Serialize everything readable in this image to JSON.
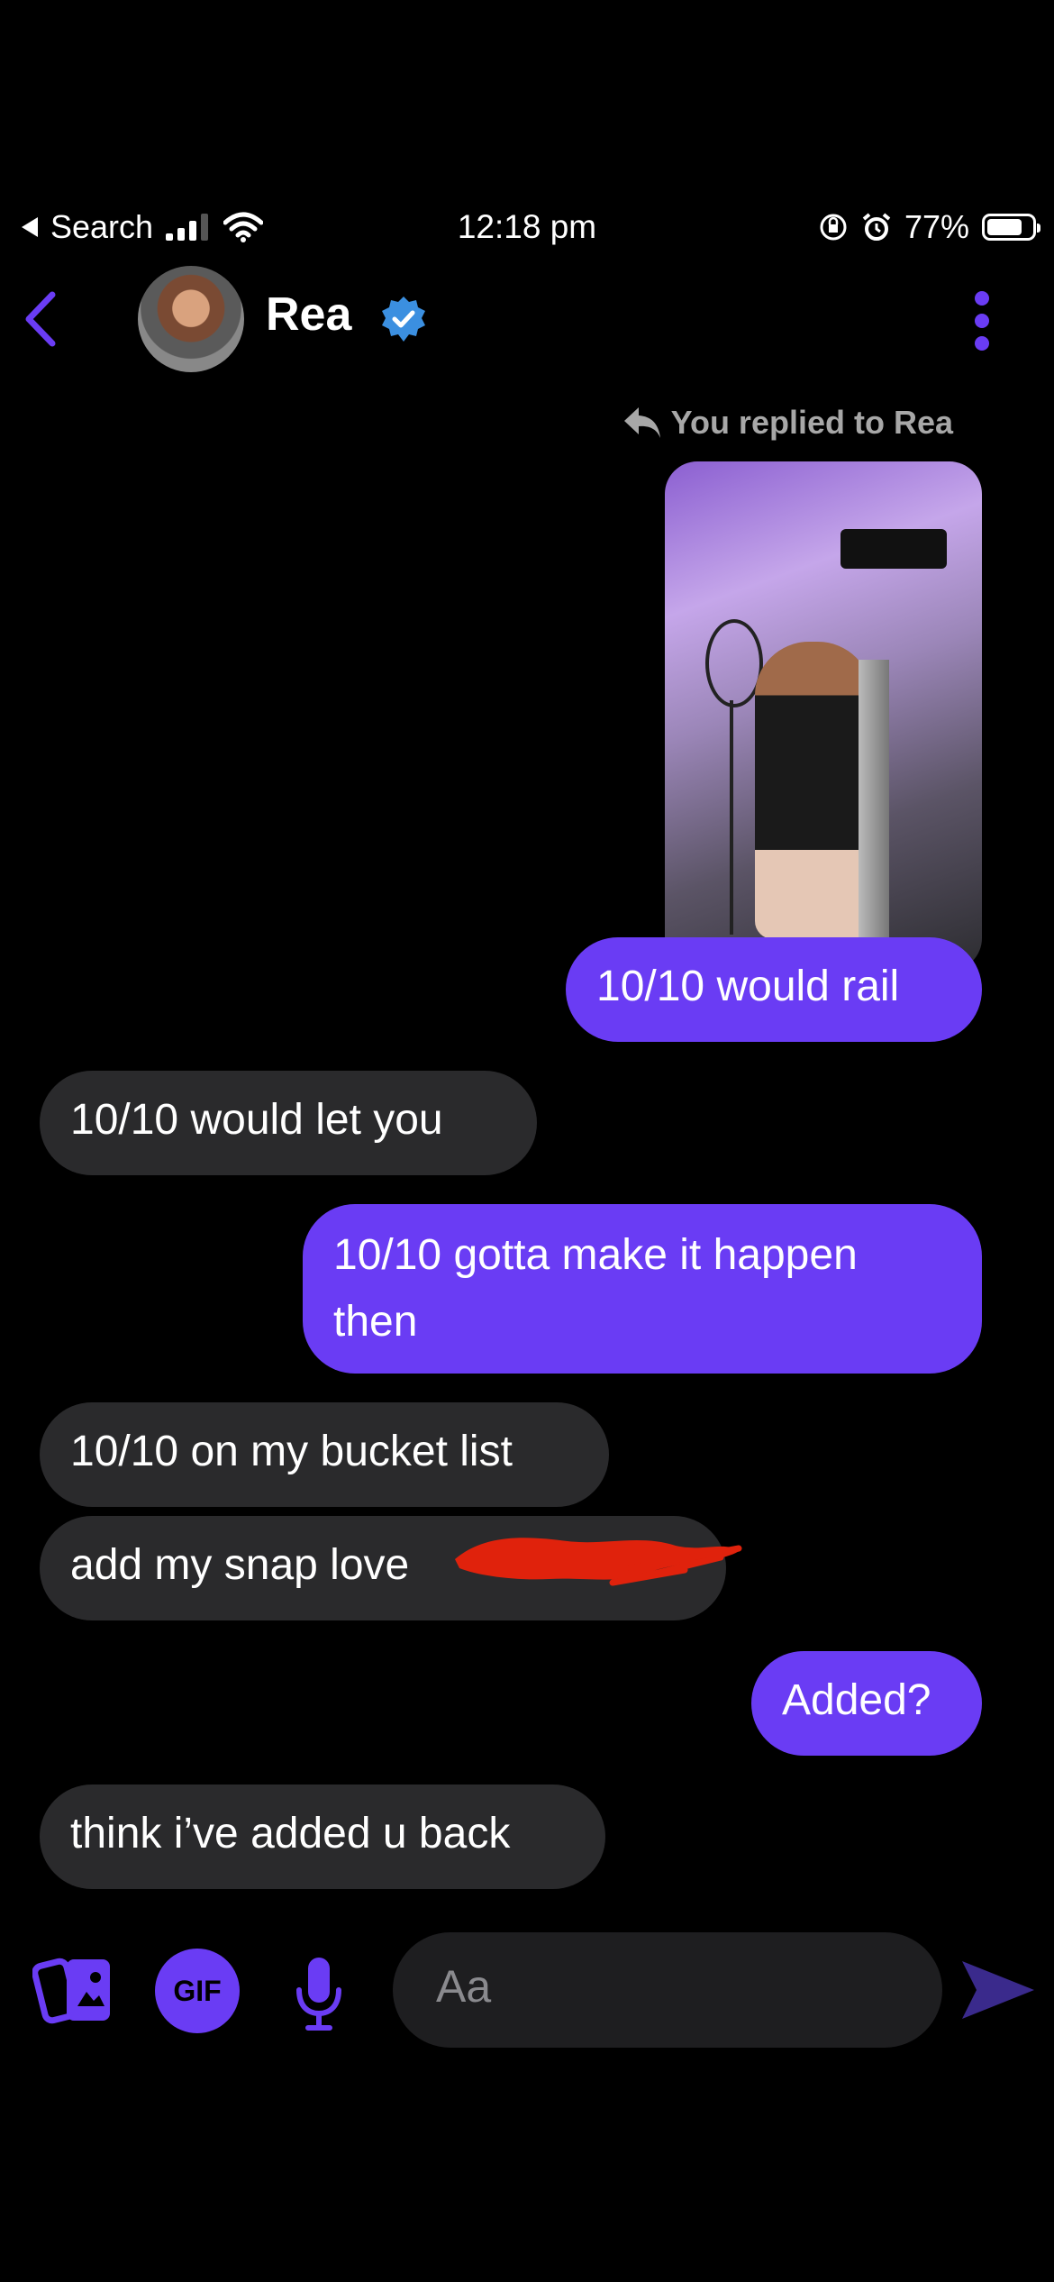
{
  "status_bar": {
    "back_app": "Search",
    "time": "12:18 pm",
    "battery": "77%"
  },
  "header": {
    "contact_name": "Rea"
  },
  "reply_label": "You replied to Rea",
  "messages": [
    {
      "side": "out",
      "text": "10/10 would rail"
    },
    {
      "side": "in",
      "text": "10/10 would let you"
    },
    {
      "side": "out",
      "text": "10/10 gotta make it happen then"
    },
    {
      "side": "in",
      "text": "10/10 on my bucket list"
    },
    {
      "side": "in",
      "text": "add my snap love"
    },
    {
      "side": "out",
      "text": "Added?"
    },
    {
      "side": "in",
      "text": "think i’ve added u back"
    }
  ],
  "composer": {
    "placeholder": "Aa",
    "gif_label": "GIF"
  },
  "colors": {
    "accent": "#6a3cf4",
    "incoming_bubble": "#2a2a2c",
    "background": "#000000",
    "verified": "#3b8fe0",
    "redaction": "#e0220c"
  }
}
